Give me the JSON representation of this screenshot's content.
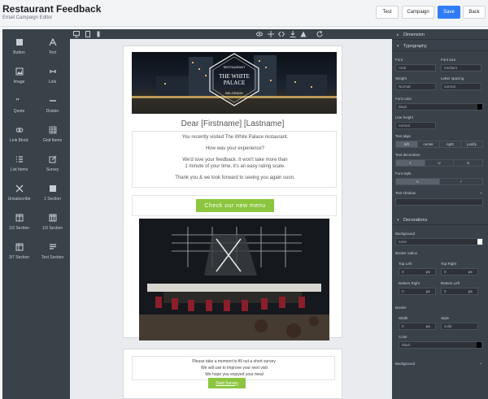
{
  "header": {
    "title": "Restaurant Feedback",
    "subtitle": "Email Campaign Editor",
    "buttons": {
      "test": "Test",
      "campaign": "Campaign",
      "save": "Save",
      "back": "Back"
    }
  },
  "blocks": [
    {
      "label": "Button",
      "icon": "button-icon"
    },
    {
      "label": "Text",
      "icon": "text-icon"
    },
    {
      "label": "Image",
      "icon": "image-icon"
    },
    {
      "label": "Link",
      "icon": "link-icon"
    },
    {
      "label": "Quote",
      "icon": "quote-icon"
    },
    {
      "label": "Divider",
      "icon": "divider-icon"
    },
    {
      "label": "Link Block",
      "icon": "link-block-icon"
    },
    {
      "label": "Grid Items",
      "icon": "grid-items-icon"
    },
    {
      "label": "List Items",
      "icon": "list-items-icon"
    },
    {
      "label": "Survey",
      "icon": "survey-icon"
    },
    {
      "label": "Unsubscribe",
      "icon": "unsubscribe-icon"
    },
    {
      "label": "1 Section",
      "icon": "one-section-icon"
    },
    {
      "label": "1/2 Section",
      "icon": "half-section-icon"
    },
    {
      "label": "1/3 Section",
      "icon": "third-section-icon"
    },
    {
      "label": "3/7 Section",
      "icon": "three-seven-section-icon"
    },
    {
      "label": "Text Section",
      "icon": "text-section-icon"
    }
  ],
  "email": {
    "hero_brand": "The White Palace",
    "hero_top": "RESTAURANT",
    "hero_bottom": "BELGRADE",
    "greeting": "Dear [Firstname] [Lastname]",
    "lines": [
      "You recently visited The White Palace restaurant.",
      "How was your experience?",
      "We'd love your feedback. It won't take more than",
      "1 minute of your time, it's an easy rating scale.",
      "Thank you & we look forward to seeing you again soon."
    ],
    "cta": "Check our new menu"
  },
  "survey": {
    "lines": [
      "Please take a moment to fill out a short survey.",
      "We will use to improve your next visit",
      "We hope you enjoyed your meal"
    ],
    "button": "Start Survey"
  },
  "panel": {
    "dimension": "Dimension",
    "typography": "Typography",
    "font_label": "Font",
    "font_value": "Arial",
    "font_size_label": "Font size",
    "font_size_value": "medium",
    "weight_label": "Weight",
    "weight_value": "Normal",
    "letter_spacing_label": "Letter spacing",
    "letter_spacing_value": "normal",
    "font_color_label": "Font color",
    "font_color_value": "black",
    "line_height_label": "Line height",
    "line_height_value": "normal",
    "text_align_label": "Text align",
    "text_align_options": [
      "left",
      "center",
      "right",
      "justify"
    ],
    "text_decoration_label": "Text decoration",
    "text_decoration_options": [
      "×",
      "U",
      "S"
    ],
    "font_style_label": "Font style",
    "font_style_options": [
      "A",
      "I"
    ],
    "text_shadow_label": "Text shadow",
    "decorations": "Decorations",
    "background_label": "Background",
    "background_value": "none",
    "border_radius_label": "Border radius",
    "top_left_label": "Top Left",
    "top_right_label": "Top Right",
    "bottom_right_label": "Bottom Right",
    "bottom_left_label": "Bottom Left",
    "zero": "0",
    "px": "px",
    "border_label": "Border",
    "width_label": "Width",
    "width_value": "0",
    "style_label": "Style",
    "style_value": "solid",
    "color_label": "Color",
    "color_value": "black",
    "background2_label": "Background"
  },
  "colors": {
    "accent": "#2f7cf6",
    "cta": "#8cc63f",
    "panel": "#394149"
  }
}
